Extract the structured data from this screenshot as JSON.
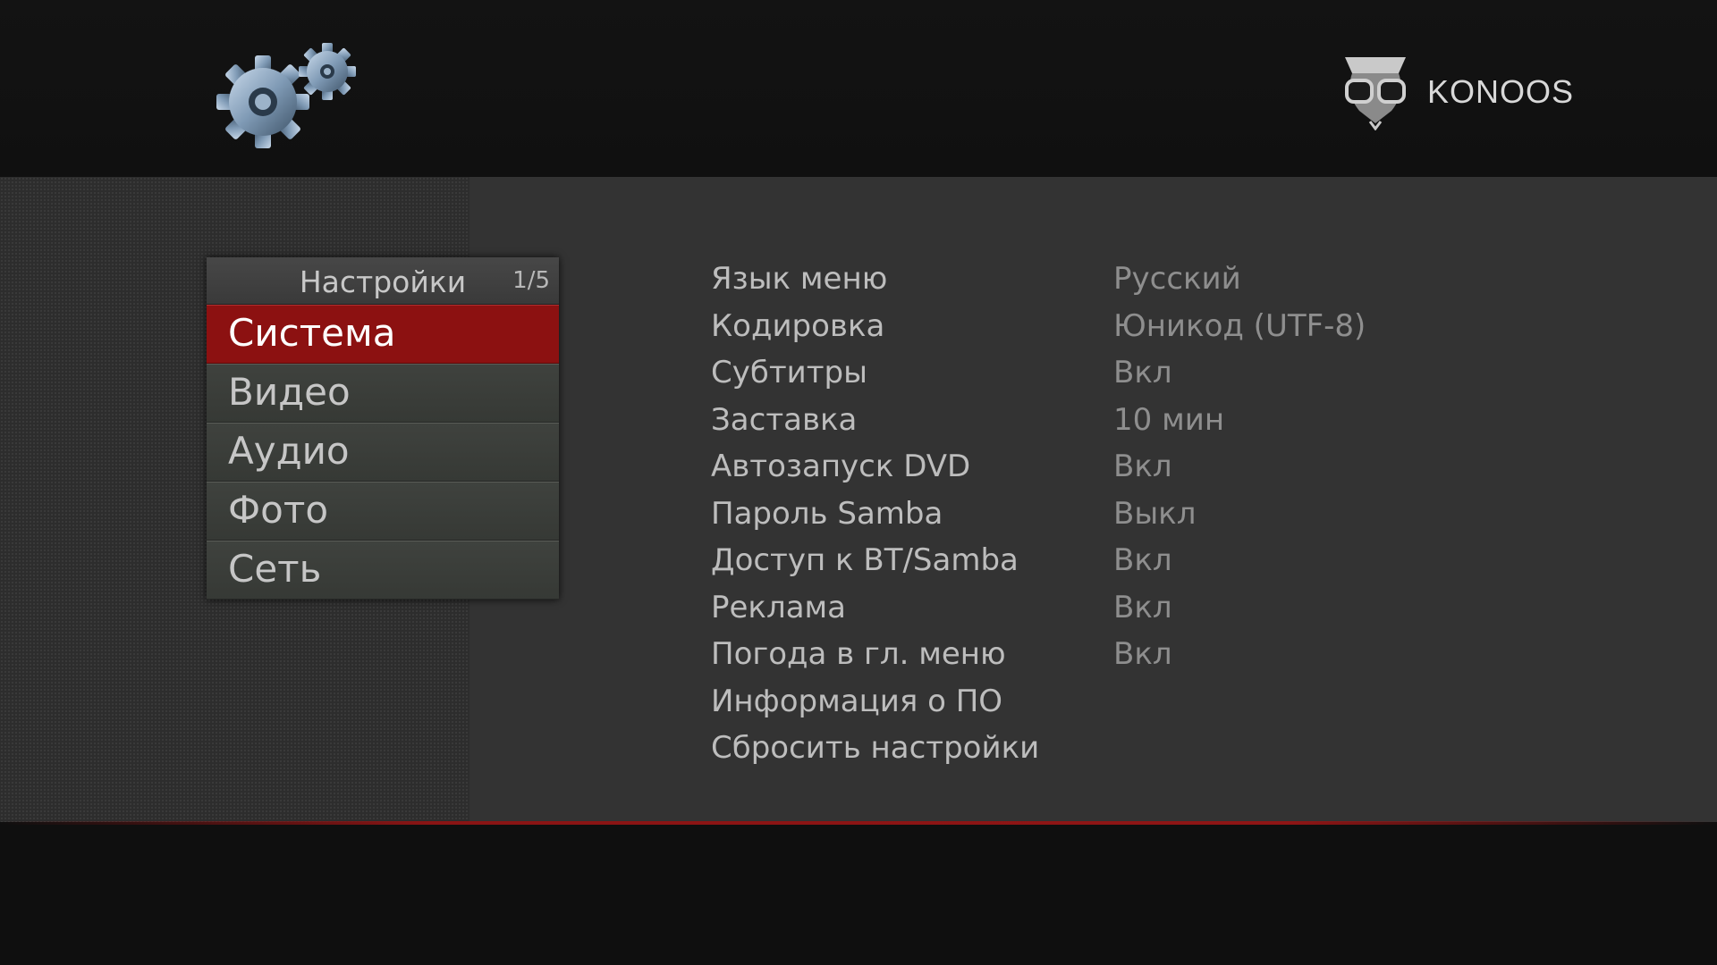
{
  "brand": {
    "name": "KONOOS"
  },
  "menu": {
    "title": "Настройки",
    "page": "1/5",
    "items": [
      {
        "label": "Система",
        "selected": true
      },
      {
        "label": "Видео",
        "selected": false
      },
      {
        "label": "Аудио",
        "selected": false
      },
      {
        "label": "Фото",
        "selected": false
      },
      {
        "label": "Сеть",
        "selected": false
      }
    ]
  },
  "settings": [
    {
      "label": "Язык меню",
      "value": "Русский"
    },
    {
      "label": "Кодировка",
      "value": "Юникод (UTF-8)"
    },
    {
      "label": "Субтитры",
      "value": "Вкл"
    },
    {
      "label": "Заставка",
      "value": "10 мин"
    },
    {
      "label": "Автозапуск DVD",
      "value": "Вкл"
    },
    {
      "label": "Пароль Samba",
      "value": "Выкл"
    },
    {
      "label": "Доступ к BT/Samba",
      "value": "Вкл"
    },
    {
      "label": "Реклама",
      "value": "Вкл"
    },
    {
      "label": "Погода в гл. меню",
      "value": "Вкл"
    },
    {
      "label": "Информация о ПО",
      "value": ""
    },
    {
      "label": "Сбросить настройки",
      "value": ""
    }
  ],
  "icons": {
    "header": "gears-icon",
    "brand": "owl-logo-icon"
  },
  "colors": {
    "accent": "#8c1111",
    "background": "#333333",
    "header": "#121212",
    "text": "#bdbdbd",
    "value_text": "#8e8e8e"
  }
}
